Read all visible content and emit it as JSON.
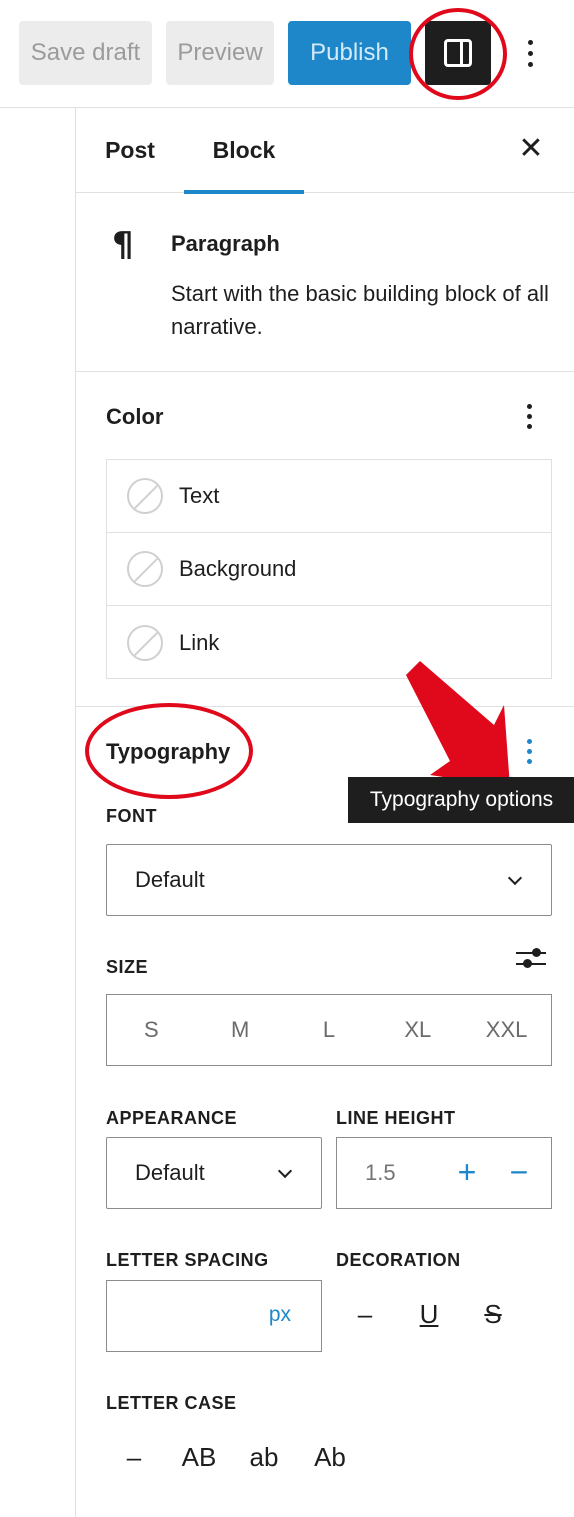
{
  "topbar": {
    "save_draft_label": "Save draft",
    "preview_label": "Preview",
    "publish_label": "Publish",
    "settings_icon": "panel-right-icon",
    "more_icon": "kebab-icon"
  },
  "sidebar": {
    "tabs": [
      {
        "label": "Post",
        "active": false
      },
      {
        "label": "Block",
        "active": true
      }
    ],
    "close_icon": "✕"
  },
  "block_card": {
    "icon": "¶",
    "title": "Paragraph",
    "description": "Start with the basic building block of all narrative."
  },
  "color": {
    "title": "Color",
    "items": [
      {
        "label": "Text"
      },
      {
        "label": "Background"
      },
      {
        "label": "Link"
      }
    ]
  },
  "typography": {
    "title": "Typography",
    "tooltip": "Typography options",
    "font_label": "FONT",
    "font_value": "Default",
    "size_label": "SIZE",
    "size_options": [
      "S",
      "M",
      "L",
      "XL",
      "XXL"
    ],
    "appearance_label": "APPEARANCE",
    "appearance_value": "Default",
    "line_height_label": "LINE HEIGHT",
    "line_height_value": "1.5",
    "line_height_plus": "+",
    "line_height_minus": "−",
    "letter_spacing_label": "LETTER SPACING",
    "letter_spacing_unit": "px",
    "decoration_label": "DECORATION",
    "decoration_options": [
      "–",
      "U",
      "S"
    ],
    "letter_case_label": "LETTER CASE",
    "letter_case_options": [
      "–",
      "AB",
      "ab",
      "Ab"
    ]
  },
  "colors": {
    "accent": "#1d87c9",
    "annotation_red": "#e0091b",
    "dark": "#1e1e1e"
  }
}
